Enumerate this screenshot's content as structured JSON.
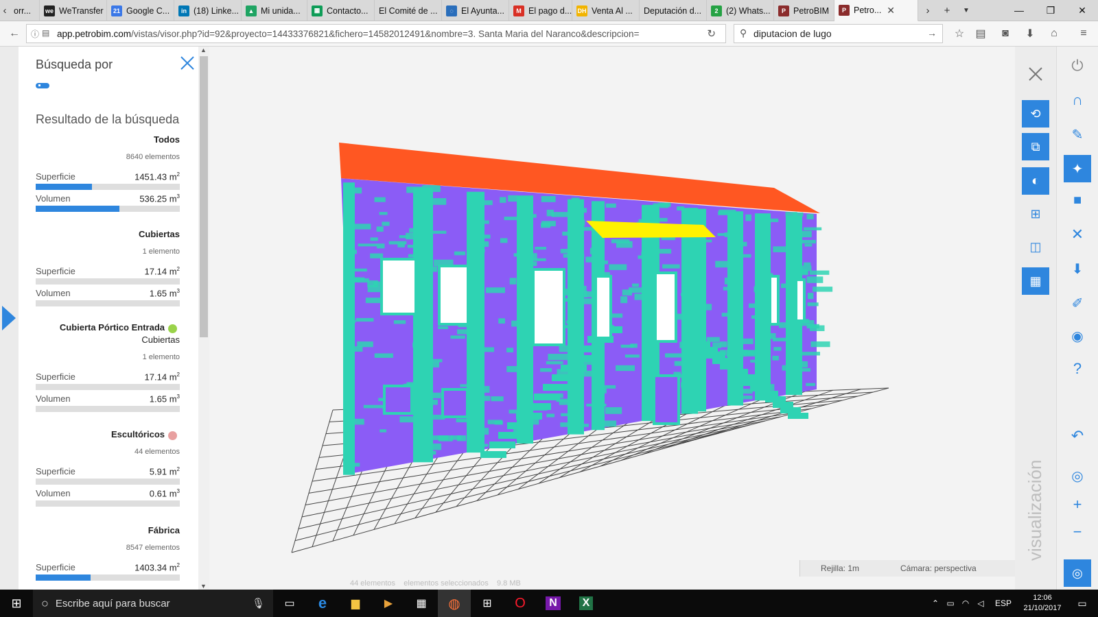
{
  "browser": {
    "tabs": [
      {
        "label": "orr...",
        "fav": "",
        "favColor": "#666"
      },
      {
        "label": "WeTransfer",
        "fav": "we",
        "favColor": "#222"
      },
      {
        "label": "Google C...",
        "fav": "21",
        "favColor": "#3b78e7"
      },
      {
        "label": "(18) Linke...",
        "fav": "in",
        "favColor": "#0077b5"
      },
      {
        "label": "Mi unida...",
        "fav": "▲",
        "favColor": "#1fa463"
      },
      {
        "label": "Contacto...",
        "fav": "▦",
        "favColor": "#0f9d58"
      },
      {
        "label": "El Comité de ...",
        "fav": "",
        "favColor": "#d9d9d9"
      },
      {
        "label": "El Ayunta...",
        "fav": "◌",
        "favColor": "#2a6ebb"
      },
      {
        "label": "El pago d...",
        "fav": "M",
        "favColor": "#d93025"
      },
      {
        "label": "Venta Al ...",
        "fav": "DH",
        "favColor": "#f2b400"
      },
      {
        "label": "Deputación d...",
        "fav": "",
        "favColor": "#d9d9d9"
      },
      {
        "label": "(2) Whats...",
        "fav": "2",
        "favColor": "#25a244"
      },
      {
        "label": "PetroBIM",
        "fav": "P",
        "favColor": "#8b2c2c"
      },
      {
        "label": "Petro...",
        "fav": "P",
        "favColor": "#8b2c2c",
        "active": true
      }
    ],
    "url_host": "app.petrobim.com",
    "url_path": "/vistas/visor.php?id=92&proyecto=14433376821&fichero=14582012491&nombre=3. Santa Maria del Naranco&descripcion=",
    "search_value": "diputacion de lugo"
  },
  "panel": {
    "title": "Búsqueda por",
    "results_title": "Resultado de la búsqueda",
    "superficie_label": "Superficie",
    "volumen_label": "Volumen",
    "unit_m2": "m",
    "groups": [
      {
        "name": "Todos",
        "count": "8640 elementos",
        "superficie": "1451.43",
        "volumen": "536.25",
        "sup_frac": 0.39,
        "vol_frac": 0.58
      },
      {
        "name": "Cubiertas",
        "count": "1 elemento",
        "superficie": "17.14",
        "volumen": "1.65",
        "sup_frac": 0.0,
        "vol_frac": 0.0
      },
      {
        "name": "Cubierta Pórtico Entrada",
        "sub": "Cubiertas",
        "dot": "#9ad34a",
        "count": "1 elemento",
        "superficie": "17.14",
        "volumen": "1.65",
        "sup_frac": 0.0,
        "vol_frac": 0.0
      },
      {
        "name": "Escultóricos",
        "dot": "#e8a0a0",
        "count": "44 elementos",
        "superficie": "5.91",
        "volumen": "0.61",
        "sup_frac": 0.0,
        "vol_frac": 0.0
      },
      {
        "name": "Fábrica",
        "count": "8547 elementos",
        "superficie": "1403.34",
        "sup_frac": 0.38
      }
    ]
  },
  "viewer": {
    "status_grid": "Rejilla: 1m",
    "status_camera": "Cámara: perspectiva",
    "vertical_label": "visualización",
    "faded_status": "44 elementos    elementos seleccionados    9.8 MB",
    "colors": {
      "roof": "#ff5722",
      "wall": "#8b5cf6",
      "stone": "#2ed3b3",
      "portico_roof": "#fff200"
    }
  },
  "taskbar": {
    "search_placeholder": "Escribe aquí para buscar",
    "lang": "ESP",
    "time": "12:06",
    "date": "21/10/2017"
  }
}
